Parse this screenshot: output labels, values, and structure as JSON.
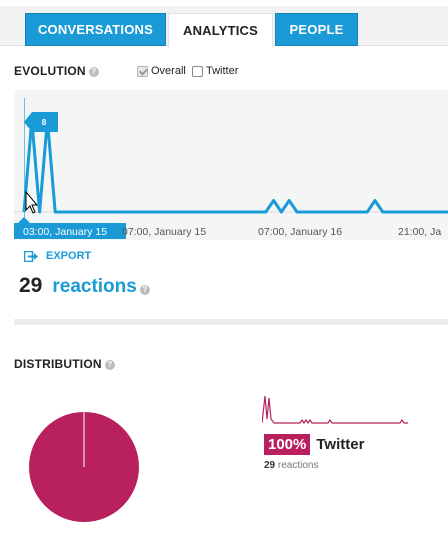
{
  "tabs": [
    {
      "label": "CONVERSATIONS"
    },
    {
      "label": "ANALYTICS"
    },
    {
      "label": "PEOPLE"
    }
  ],
  "evolution": {
    "title": "EVOLUTION",
    "help": "?",
    "filters": [
      {
        "label": "Overall",
        "checked": true
      },
      {
        "label": "Twitter",
        "checked": false
      }
    ]
  },
  "chart_data": {
    "type": "line",
    "x_labels": [
      "03:00, January 15",
      "07:00, January 15",
      "07:00, January 16",
      "21:00, Ja"
    ],
    "values": [
      0,
      8,
      0,
      8,
      0,
      0,
      0,
      0,
      0,
      0,
      0,
      0,
      0,
      0,
      0,
      0,
      0,
      0,
      0,
      0,
      0,
      0,
      0,
      0,
      0,
      0,
      0,
      0,
      0,
      0,
      0,
      0,
      1,
      0,
      1,
      0,
      0,
      0,
      0,
      0,
      0,
      0,
      0,
      0,
      0,
      1,
      0,
      0,
      0,
      0,
      0,
      0,
      0,
      0,
      0,
      0
    ],
    "tooltip": {
      "value": "8",
      "x_label": "03:00, January 15"
    },
    "ylim": [
      0,
      8
    ],
    "line_color": "#1a9ad6"
  },
  "export": {
    "label": "EXPORT"
  },
  "totals": {
    "count": "29",
    "label": "reactions",
    "help": "?"
  },
  "distribution": {
    "title": "DISTRIBUTION",
    "help": "?",
    "pie": [
      {
        "name": "Twitter",
        "value": 100,
        "color": "#b8215e"
      }
    ],
    "share": {
      "percent": "100%",
      "name": "Twitter",
      "count": "29",
      "unit": "reactions"
    }
  }
}
